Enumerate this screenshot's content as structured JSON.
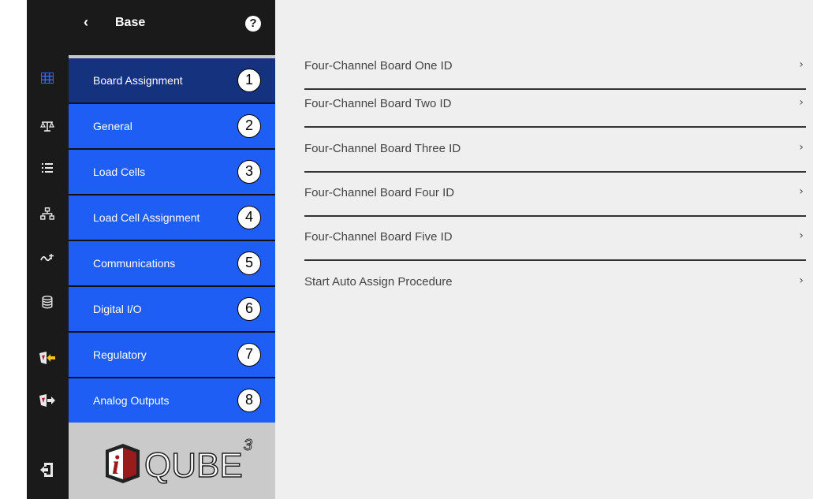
{
  "nav": {
    "back_label": "‹",
    "title": "Base",
    "help_label": "?",
    "items": [
      {
        "label": "Board Assignment",
        "num": "1"
      },
      {
        "label": "General",
        "num": "2"
      },
      {
        "label": "Load Cells",
        "num": "3"
      },
      {
        "label": "Load Cell Assignment",
        "num": "4"
      },
      {
        "label": "Communications",
        "num": "5"
      },
      {
        "label": "Digital I/O",
        "num": "6"
      },
      {
        "label": "Regulatory",
        "num": "7"
      },
      {
        "label": "Analog Outputs",
        "num": "8"
      }
    ],
    "selected_index": 0
  },
  "logo": {
    "letter": "i",
    "text": "QUBE",
    "sup": "3"
  },
  "rail": {
    "icons": [
      "grid-icon",
      "scale-icon",
      "list-icon",
      "network-icon",
      "signal-icon",
      "database-icon",
      "import-icon",
      "export-icon",
      "file-exit-icon"
    ],
    "active_index": 0
  },
  "content": {
    "rows": [
      {
        "label": "Four-Channel Board One ID"
      },
      {
        "label": "Four-Channel Board Two ID"
      },
      {
        "label": "Four-Channel Board Three ID"
      },
      {
        "label": "Four-Channel Board Four ID"
      },
      {
        "label": "Four-Channel Board Five ID"
      },
      {
        "label": "Start Auto Assign Procedure"
      }
    ],
    "chevron": "›"
  },
  "colors": {
    "nav_blue": "#1f5ef5",
    "nav_selected": "#14327e",
    "rail_bg": "#1a1a1a",
    "active_icon": "#2f6bf0"
  }
}
